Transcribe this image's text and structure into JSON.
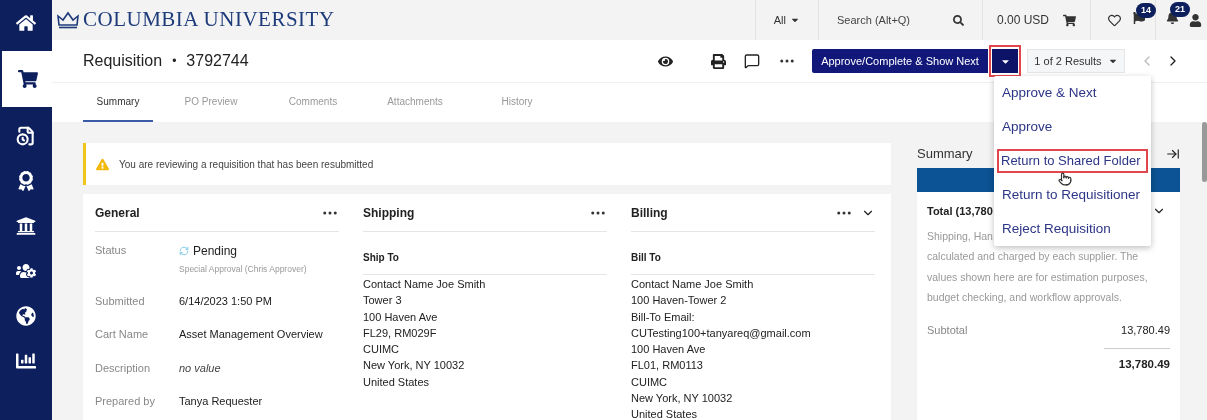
{
  "sidebar": {
    "items": [
      {
        "kind": "home",
        "selected": false
      },
      {
        "kind": "cart",
        "selected": true
      },
      {
        "kind": "documents",
        "selected": false
      },
      {
        "kind": "award",
        "selected": false
      },
      {
        "kind": "bank",
        "selected": false
      },
      {
        "kind": "people",
        "selected": false
      },
      {
        "kind": "globe",
        "selected": false
      },
      {
        "kind": "chart",
        "selected": false
      }
    ]
  },
  "brand": "COLUMBIA UNIVERSITY",
  "top_bar": {
    "scope": "All",
    "search": {
      "placeholder": "Search (Alt+Q)"
    },
    "cart_total": "0.00 USD",
    "flag_badge": "14",
    "bell_badge": "21"
  },
  "header": {
    "title": "Requisition",
    "separator": "•",
    "number": "3792744",
    "primary_button": "Approve/Complete & Show Next",
    "caret_button": {
      "expanded": true,
      "highlighted": true
    },
    "results": "1 of 2 Results",
    "menu": [
      {
        "label": "Approve & Next",
        "highlighted": false
      },
      {
        "label": "Approve",
        "highlighted": false
      },
      {
        "label": "Return to Shared Folder",
        "highlighted": true
      },
      {
        "label": "Return to Requisitioner",
        "highlighted": false
      },
      {
        "label": "Reject Requisition",
        "highlighted": false
      }
    ]
  },
  "tabs": [
    {
      "label": "Summary",
      "selected": true
    },
    {
      "label": "PO Preview",
      "selected": false
    },
    {
      "label": "Comments",
      "selected": false
    },
    {
      "label": "Attachments",
      "selected": false
    },
    {
      "label": "History",
      "selected": false
    }
  ],
  "alert": "You are reviewing a requisition that has been resubmitted",
  "general": {
    "title": "General",
    "fields": [
      {
        "label": "Status",
        "value": "Pending",
        "sub": "Special Approval (Chris Approver)",
        "kind": "status"
      },
      {
        "label": "Submitted",
        "value": "6/14/2023 1:50 PM",
        "kind": "text"
      },
      {
        "label": "Cart Name",
        "value": "Asset Management Overview",
        "kind": "text"
      },
      {
        "label": "Description",
        "value": "no value",
        "kind": "empty"
      },
      {
        "label": "Prepared by",
        "value": "Tanya Requester",
        "kind": "text"
      }
    ]
  },
  "shipping": {
    "title": "Shipping",
    "subtitle": "Ship To",
    "lines": [
      "Contact Name Joe Smith",
      "Tower 3",
      "100 Haven Ave",
      "FL29, RM029F",
      "CUIMC",
      "New York, NY 10032",
      "United States"
    ]
  },
  "billing": {
    "title": "Billing",
    "subtitle": "Bill To",
    "lines": [
      "Contact Name Joe Smith",
      "100 Haven-Tower 2",
      "Bill-To Email:",
      "CUTesting100+tanyareq@gmail.com",
      "100 Haven Ave",
      "FL01, RM0113",
      "CUIMC",
      "New York, NY 10032",
      "United States"
    ]
  },
  "summary": {
    "title": "Summary",
    "total_label": "Total (13,780",
    "note_lines": [
      "Shipping, Han",
      "calculated and charged by each supplier. The",
      "values shown here are for estimation purposes,",
      "budget checking, and workflow approvals."
    ],
    "subtotal_label": "Subtotal",
    "subtotal": "13,780.49",
    "total": "13,780.49"
  }
}
